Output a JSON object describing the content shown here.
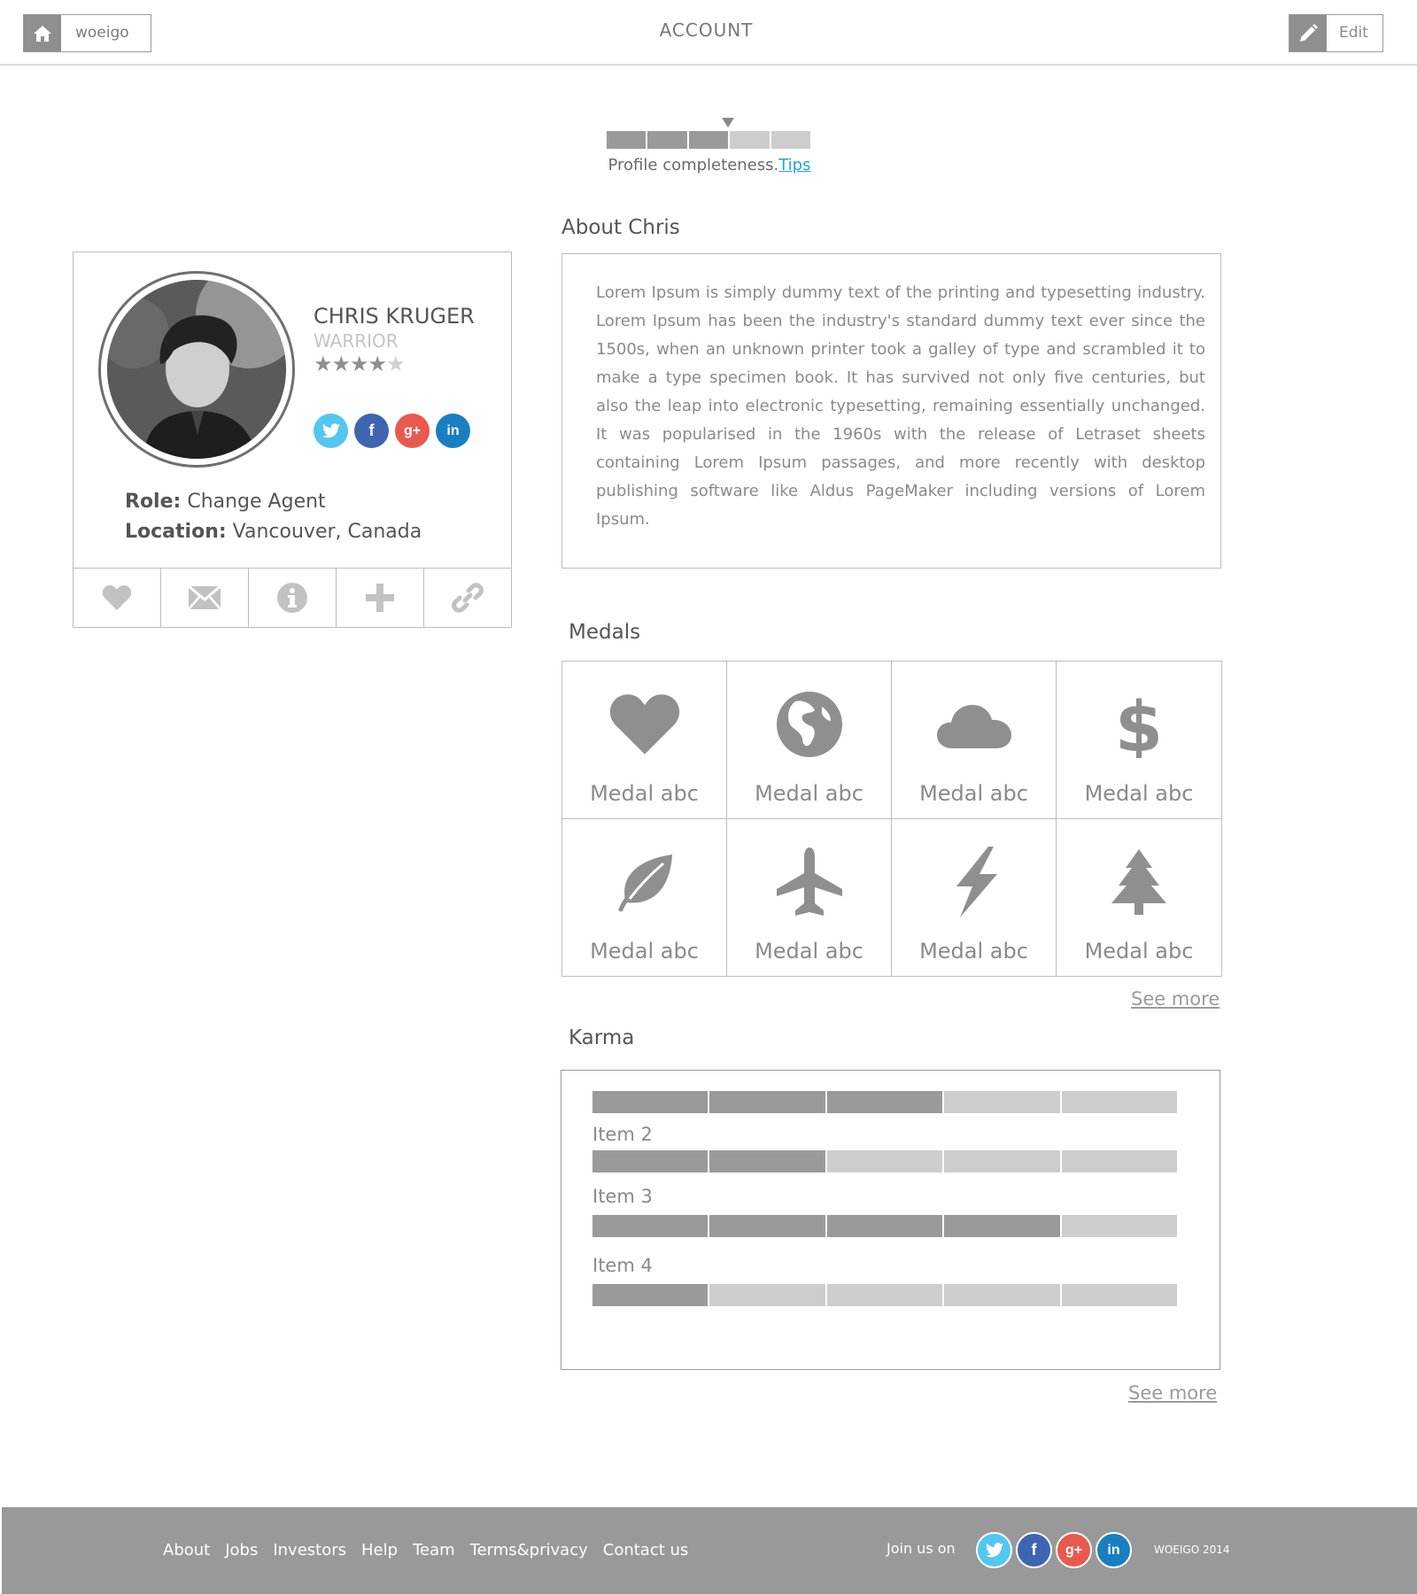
{
  "header": {
    "brand": "woeigo",
    "title": "ACCOUNT",
    "edit_label": "Edit"
  },
  "completeness": {
    "text": "Profile completeness.",
    "tips_link": "Tips",
    "segments_total": 5,
    "segments_filled": 3
  },
  "profile": {
    "name": "CHRIS KRUGER",
    "rank": "WARRIOR",
    "rating": 4,
    "rating_max": 5,
    "role_label": "Role:",
    "role_value": "Change Agent",
    "location_label": "Location:",
    "location_value": "Vancouver, Canada",
    "socials": [
      {
        "icon": "twitter-icon",
        "glyph": "t"
      },
      {
        "icon": "facebook-icon",
        "glyph": "f"
      },
      {
        "icon": "google-plus-icon",
        "glyph": "g+"
      },
      {
        "icon": "linkedin-icon",
        "glyph": "in"
      }
    ],
    "actions": [
      "heart-icon",
      "mail-icon",
      "info-icon",
      "plus-icon",
      "link-icon"
    ]
  },
  "about": {
    "title": "About Chris",
    "text": "Lorem Ipsum is simply dummy text of the printing and typesetting industry. Lorem Ipsum has been the industry's standard dummy text ever since the 1500s, when an unknown printer took a galley of type and scrambled it to make a type specimen book. It has survived not only five centuries, but also the leap into electronic typesetting, remaining essentially unchanged. It was popularised in the 1960s with the release of Letraset sheets containing Lorem Ipsum passages, and more recently with desktop publishing software like Aldus PageMaker including versions of Lorem Ipsum."
  },
  "medals": {
    "title": "Medals",
    "items": [
      {
        "icon": "heart-icon",
        "label": "Medal abc"
      },
      {
        "icon": "globe-icon",
        "label": "Medal abc"
      },
      {
        "icon": "cloud-icon",
        "label": "Medal abc"
      },
      {
        "icon": "dollar-icon",
        "label": "Medal abc"
      },
      {
        "icon": "leaf-icon",
        "label": "Medal abc"
      },
      {
        "icon": "airplane-icon",
        "label": "Medal abc"
      },
      {
        "icon": "lightning-icon",
        "label": "Medal abc"
      },
      {
        "icon": "tree-icon",
        "label": "Medal abc"
      }
    ],
    "see_more": "See more"
  },
  "karma": {
    "title": "Karma",
    "segments_total": 5,
    "items": [
      {
        "label": "",
        "filled": 3
      },
      {
        "label": "Item 2",
        "filled": 2
      },
      {
        "label": "Item 3",
        "filled": 4
      },
      {
        "label": "Item 4",
        "filled": 1
      }
    ],
    "see_more": "See more"
  },
  "footer": {
    "links": [
      "About",
      "Jobs",
      "Investors",
      "Help",
      "Team",
      "Terms&privacy",
      "Contact us"
    ],
    "join_text": "Join us on",
    "copyright": "WOEIGO 2014"
  },
  "colors": {
    "bar_filled": "#9a9a9a",
    "bar_empty": "#cdcdcd",
    "link": "#2a9fd6",
    "twitter": "#55c6ef",
    "facebook": "#3f65b0",
    "google_plus": "#e85a4f",
    "linkedin": "#1a7fc1",
    "footer_bg": "#999999"
  }
}
